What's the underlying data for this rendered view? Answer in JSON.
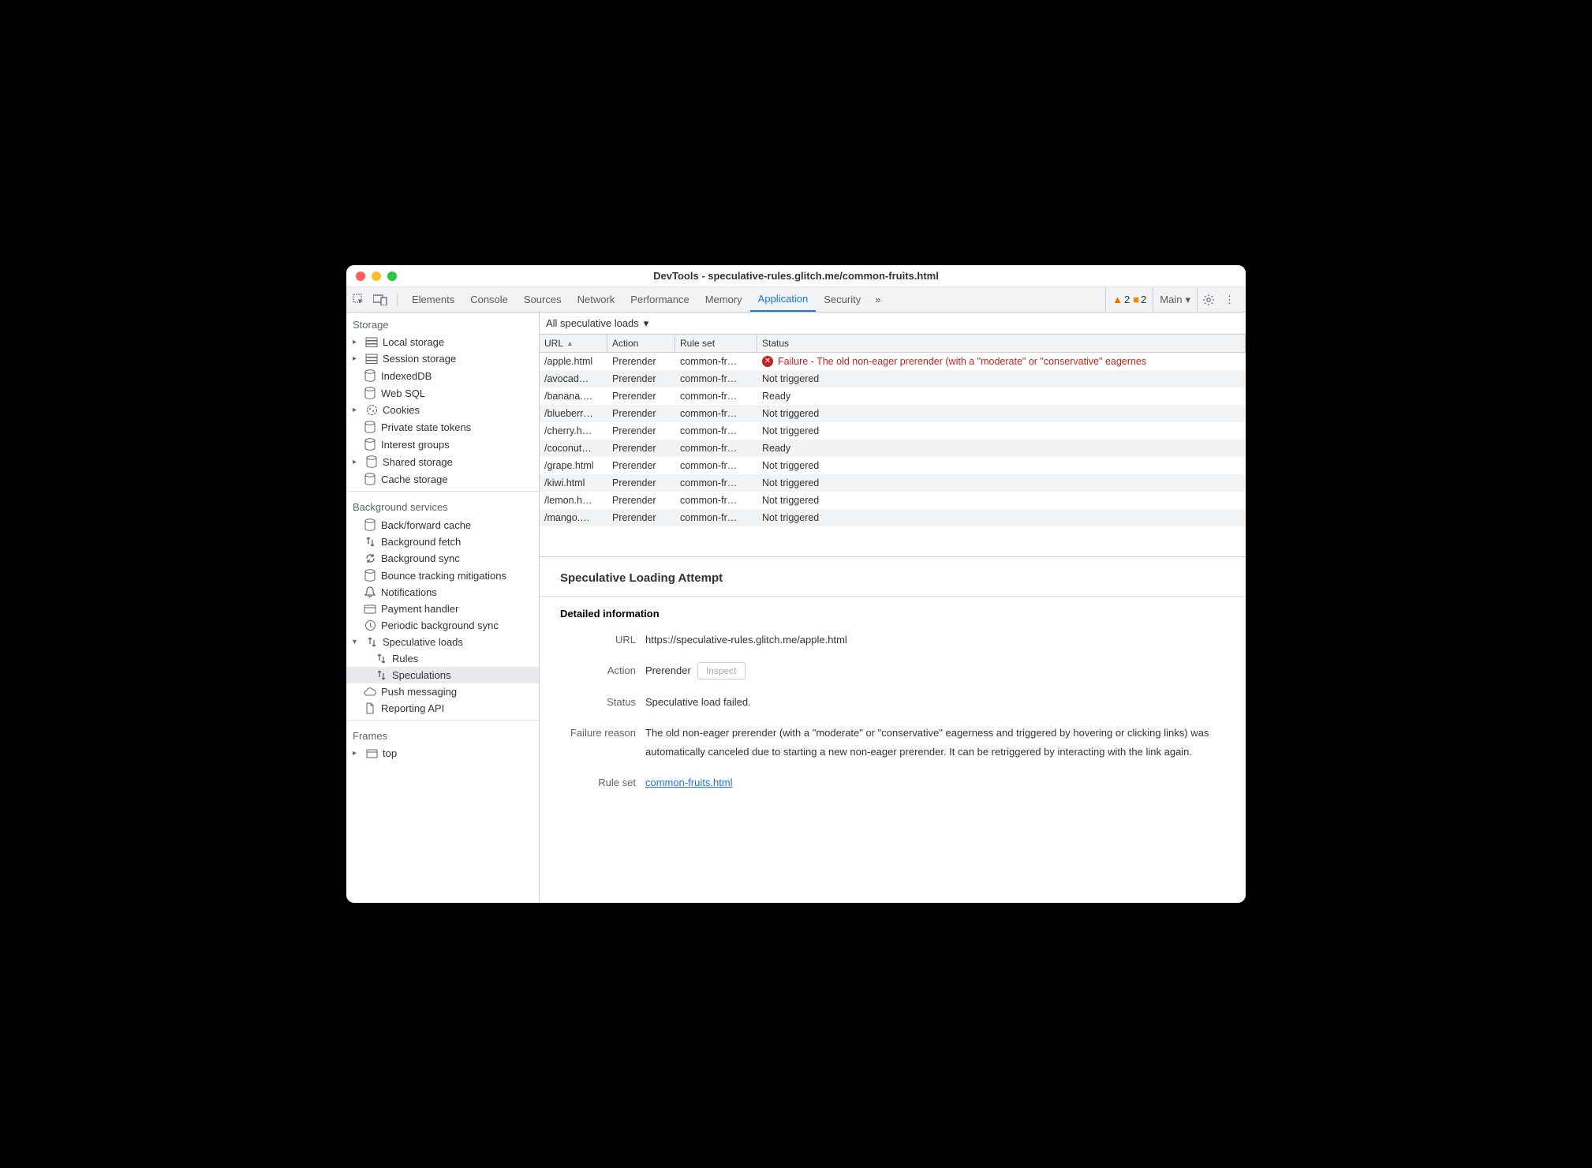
{
  "window": {
    "title": "DevTools - speculative-rules.glitch.me/common-fruits.html"
  },
  "toolbar": {
    "tabs": [
      "Elements",
      "Console",
      "Sources",
      "Network",
      "Performance",
      "Memory",
      "Application",
      "Security"
    ],
    "active_tab": "Application",
    "more": "»",
    "warn_count": "2",
    "issue_count": "2",
    "main_label": "Main"
  },
  "sidebar": {
    "storage": {
      "title": "Storage",
      "items": [
        {
          "label": "Local storage",
          "icon": "db",
          "expandable": true
        },
        {
          "label": "Session storage",
          "icon": "db",
          "expandable": true
        },
        {
          "label": "IndexedDB",
          "icon": "cyl"
        },
        {
          "label": "Web SQL",
          "icon": "cyl"
        },
        {
          "label": "Cookies",
          "icon": "cookie",
          "expandable": true
        },
        {
          "label": "Private state tokens",
          "icon": "cyl"
        },
        {
          "label": "Interest groups",
          "icon": "cyl"
        },
        {
          "label": "Shared storage",
          "icon": "cyl",
          "expandable": true
        },
        {
          "label": "Cache storage",
          "icon": "cyl"
        }
      ]
    },
    "bg": {
      "title": "Background services",
      "items": [
        {
          "label": "Back/forward cache",
          "icon": "cyl"
        },
        {
          "label": "Background fetch",
          "icon": "arrows"
        },
        {
          "label": "Background sync",
          "icon": "sync"
        },
        {
          "label": "Bounce tracking mitigations",
          "icon": "cyl"
        },
        {
          "label": "Notifications",
          "icon": "bell"
        },
        {
          "label": "Payment handler",
          "icon": "card"
        },
        {
          "label": "Periodic background sync",
          "icon": "clock"
        },
        {
          "label": "Speculative loads",
          "icon": "arrows",
          "expanded": true
        },
        {
          "label": "Rules",
          "icon": "arrows",
          "child": true
        },
        {
          "label": "Speculations",
          "icon": "arrows",
          "child": true,
          "selected": true
        },
        {
          "label": "Push messaging",
          "icon": "cloud"
        },
        {
          "label": "Reporting API",
          "icon": "doc"
        }
      ]
    },
    "frames": {
      "title": "Frames",
      "items": [
        {
          "label": "top",
          "icon": "frame",
          "expandable": true
        }
      ]
    }
  },
  "filter": {
    "label": "All speculative loads"
  },
  "table": {
    "headers": {
      "url": "URL",
      "action": "Action",
      "ruleset": "Rule set",
      "status": "Status"
    },
    "rows": [
      {
        "url": "/apple.html",
        "action": "Prerender",
        "ruleset": "common-fr…",
        "status": "Failure - The old non-eager prerender (with a \"moderate\" or \"conservative\" eagernes",
        "error": true
      },
      {
        "url": "/avocad…",
        "action": "Prerender",
        "ruleset": "common-fr…",
        "status": "Not triggered"
      },
      {
        "url": "/banana.…",
        "action": "Prerender",
        "ruleset": "common-fr…",
        "status": "Ready"
      },
      {
        "url": "/blueberr…",
        "action": "Prerender",
        "ruleset": "common-fr…",
        "status": "Not triggered"
      },
      {
        "url": "/cherry.h…",
        "action": "Prerender",
        "ruleset": "common-fr…",
        "status": "Not triggered"
      },
      {
        "url": "/coconut…",
        "action": "Prerender",
        "ruleset": "common-fr…",
        "status": "Ready"
      },
      {
        "url": "/grape.html",
        "action": "Prerender",
        "ruleset": "common-fr…",
        "status": "Not triggered"
      },
      {
        "url": "/kiwi.html",
        "action": "Prerender",
        "ruleset": "common-fr…",
        "status": "Not triggered"
      },
      {
        "url": "/lemon.h…",
        "action": "Prerender",
        "ruleset": "common-fr…",
        "status": "Not triggered"
      },
      {
        "url": "/mango.…",
        "action": "Prerender",
        "ruleset": "common-fr…",
        "status": "Not triggered"
      }
    ]
  },
  "detail": {
    "heading": "Speculative Loading Attempt",
    "section": "Detailed information",
    "labels": {
      "url": "URL",
      "action": "Action",
      "status": "Status",
      "failure": "Failure reason",
      "ruleset": "Rule set"
    },
    "values": {
      "url": "https://speculative-rules.glitch.me/apple.html",
      "action": "Prerender",
      "inspect": "Inspect",
      "status": "Speculative load failed.",
      "failure": "The old non-eager prerender (with a \"moderate\" or \"conservative\" eagerness and triggered by hovering or clicking links) was automatically canceled due to starting a new non-eager prerender. It can be retriggered by interacting with the link again.",
      "ruleset": "common-fruits.html"
    }
  }
}
